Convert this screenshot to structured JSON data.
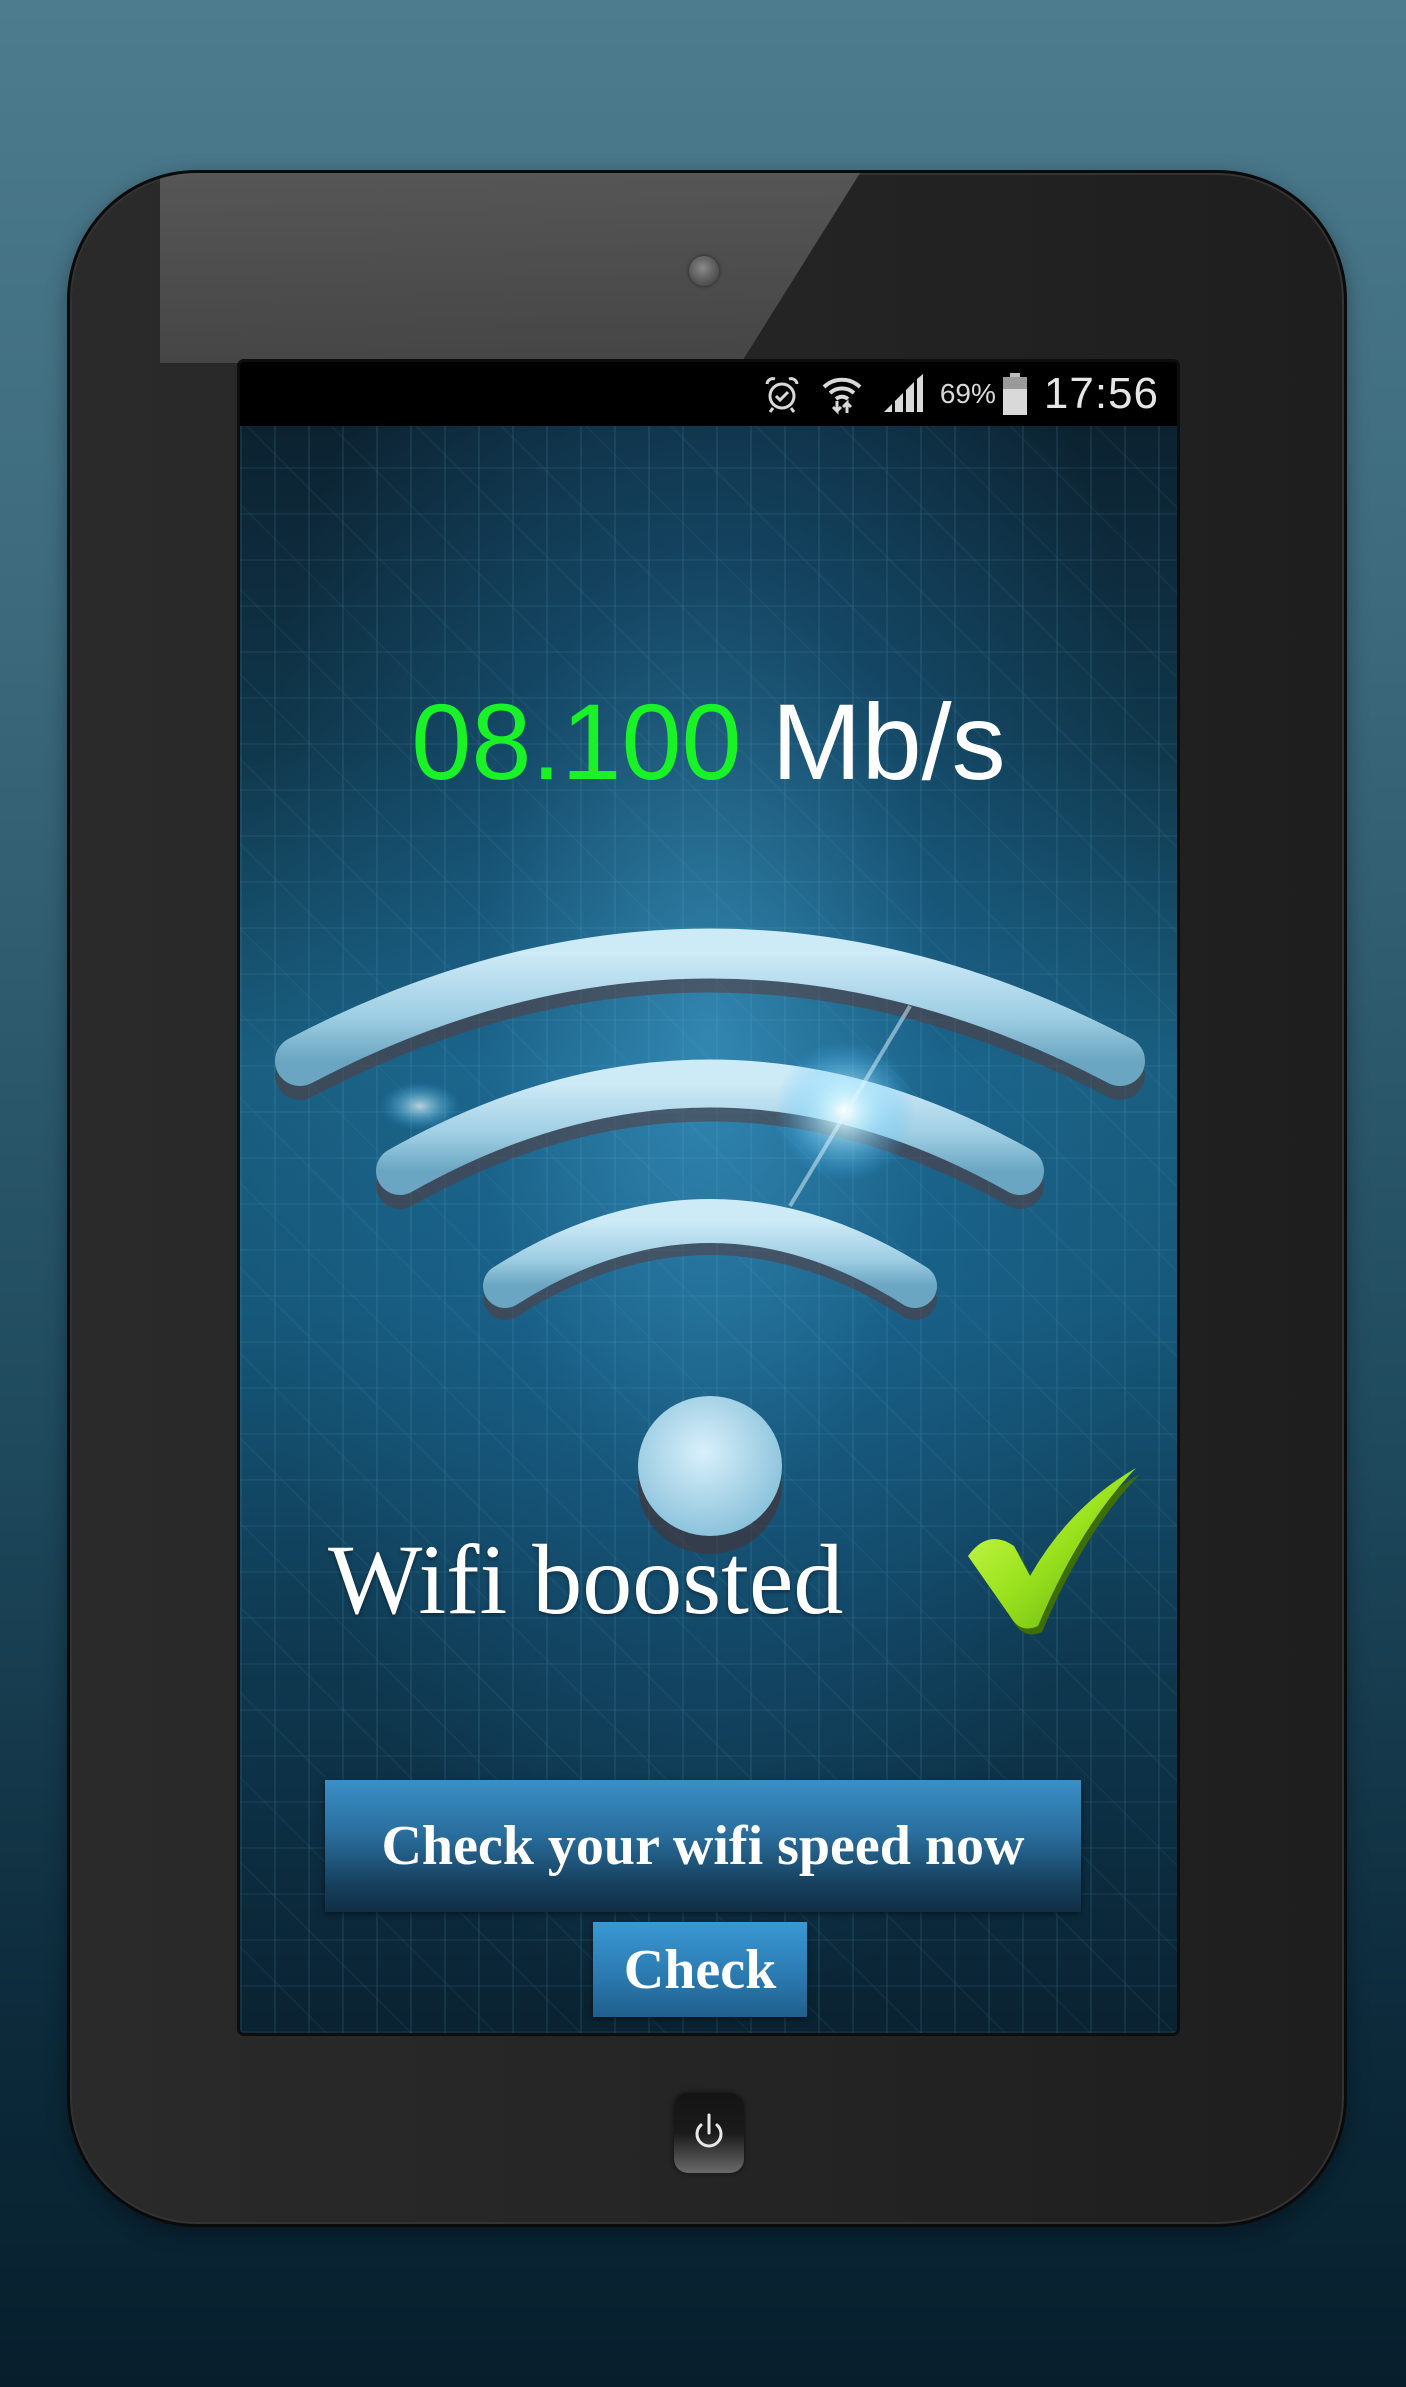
{
  "status_bar": {
    "icons": [
      "alarm-icon",
      "wifi-data-icon",
      "signal-icon",
      "battery-icon"
    ],
    "battery_percent": "69%",
    "time": "17:56"
  },
  "app": {
    "speed_value": "08.100",
    "speed_unit": "Mb/s",
    "status_message": "Wifi boosted",
    "status_icon": "checkmark-icon",
    "check_speed_button": "Check your wifi speed now",
    "check_button": "Check"
  },
  "colors": {
    "speed_value": "#19f227",
    "speed_unit": "#ffffff",
    "button_top": "#3a8fc6",
    "button_bottom": "#112f45",
    "checkmark": "#8fdc1a"
  },
  "device": {
    "camera_icon": "camera-icon",
    "power_icon": "power-icon"
  }
}
